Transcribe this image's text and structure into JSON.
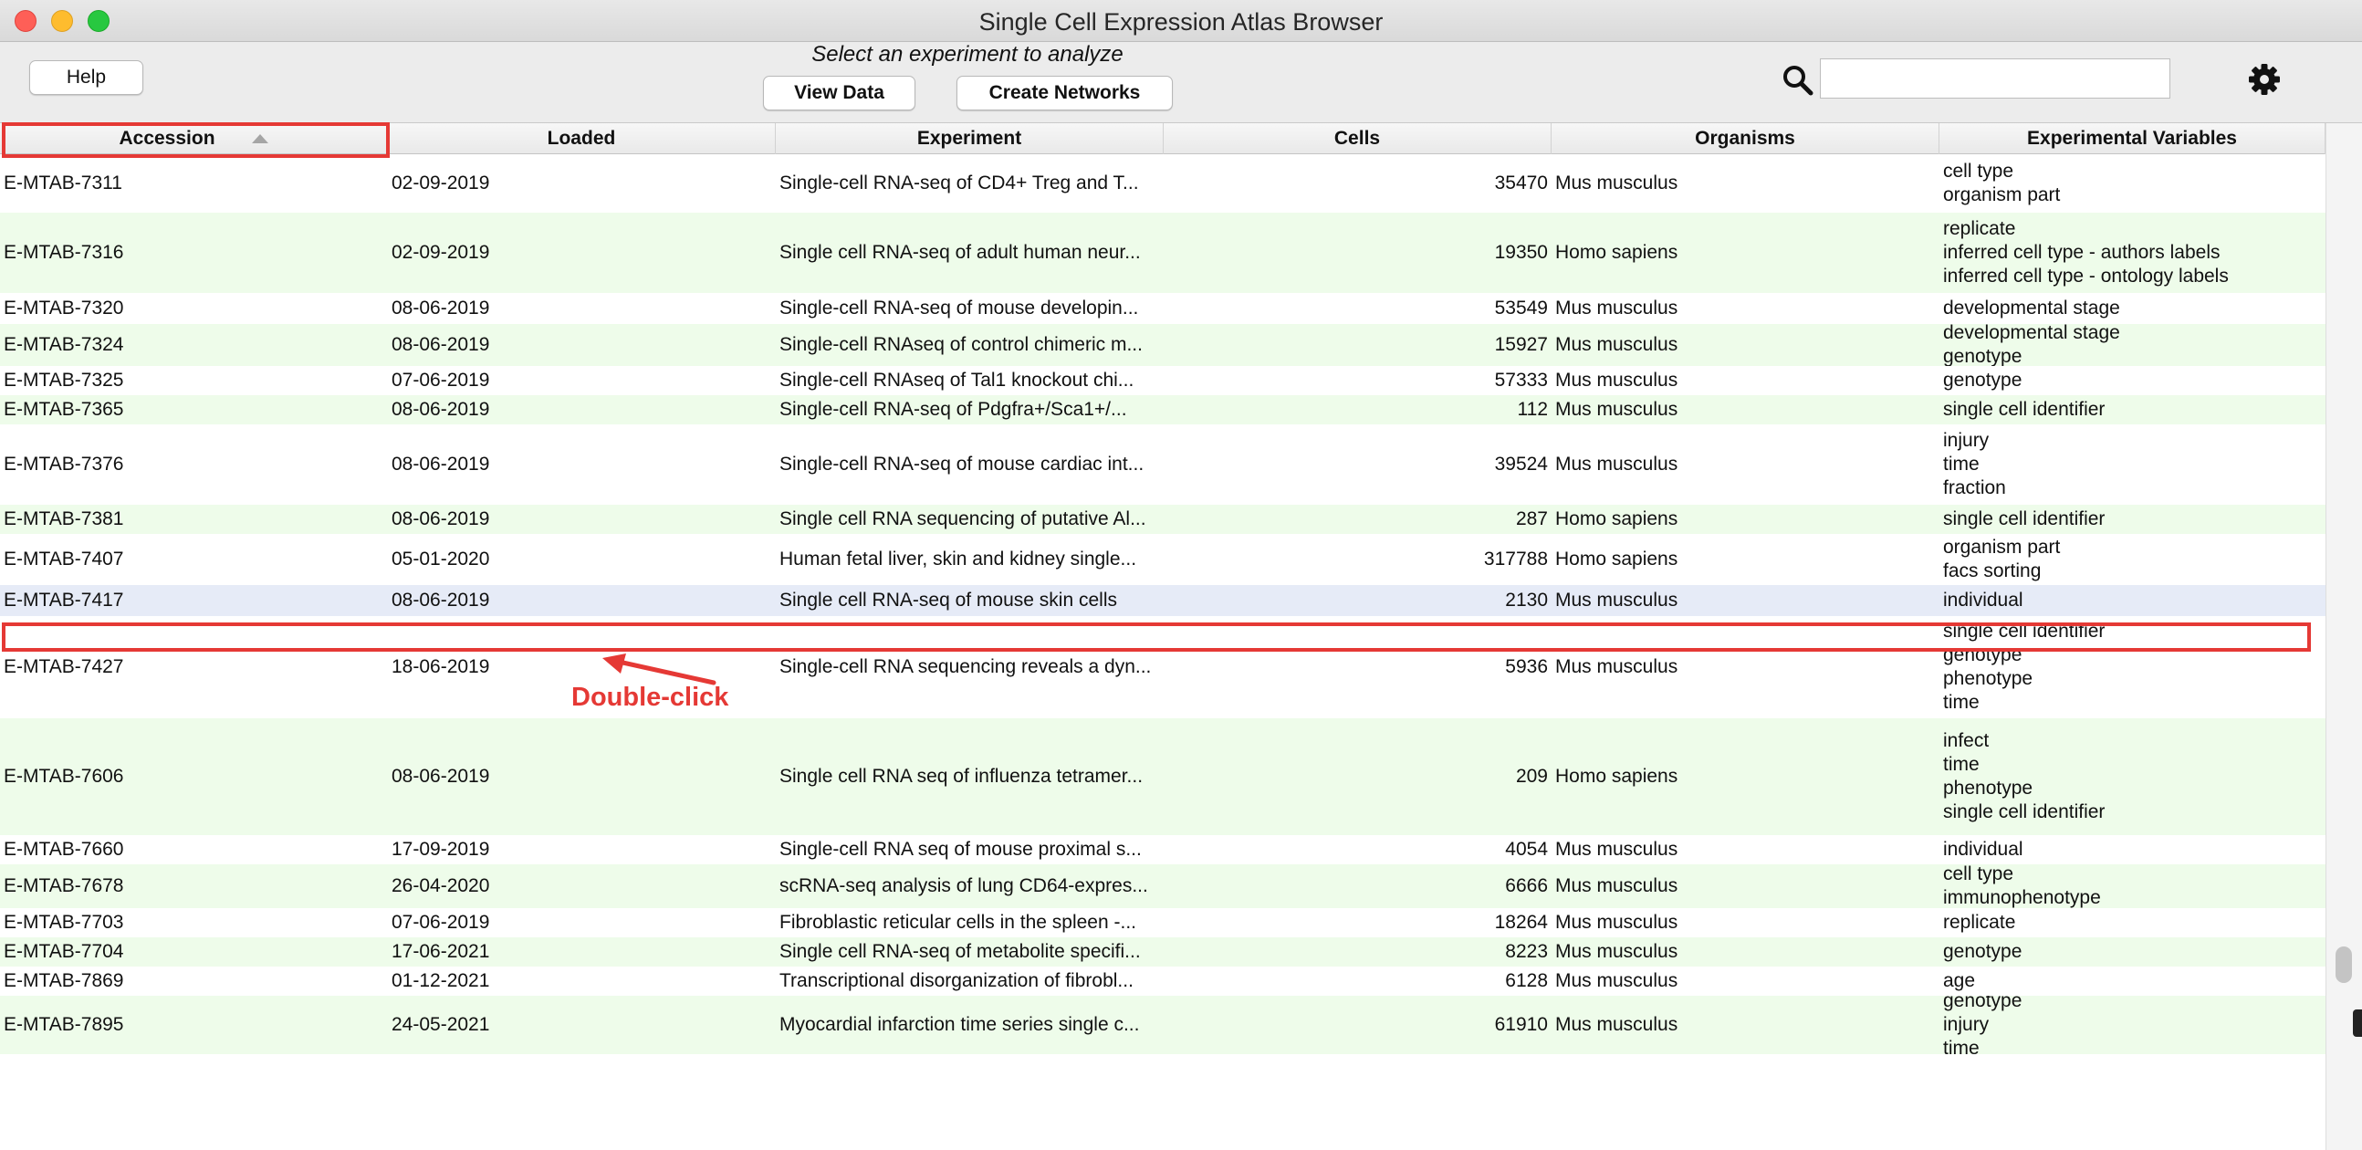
{
  "window": {
    "title": "Single Cell Expression Atlas Browser"
  },
  "toolbar": {
    "help_label": "Help",
    "prompt": "Select an experiment to analyze",
    "view_data_label": "View Data",
    "create_networks_label": "Create Networks",
    "search_value": "",
    "search_icon": "search-icon",
    "settings_icon": "gear-icon"
  },
  "table": {
    "columns": [
      "Accession",
      "Loaded",
      "Experiment",
      "Cells",
      "Organisms",
      "Experimental Variables"
    ],
    "sorted_by": "Accession",
    "rows": [
      {
        "accession": "E-MTAB-7311",
        "loaded": "02-09-2019",
        "experiment": "Single-cell RNA-seq of CD4+ Treg and T...",
        "cells": "35470",
        "organism": "Mus musculus",
        "variables": [
          "cell type",
          "organism part"
        ]
      },
      {
        "accession": "E-MTAB-7316",
        "loaded": "02-09-2019",
        "experiment": "Single cell RNA-seq of adult human neur...",
        "cells": "19350",
        "organism": "Homo sapiens",
        "variables": [
          "replicate",
          "inferred cell type - authors labels",
          "inferred cell type - ontology labels"
        ]
      },
      {
        "accession": "E-MTAB-7320",
        "loaded": "08-06-2019",
        "experiment": "Single-cell RNA-seq of mouse developin...",
        "cells": "53549",
        "organism": "Mus musculus",
        "variables": [
          "developmental stage"
        ]
      },
      {
        "accession": "E-MTAB-7324",
        "loaded": "08-06-2019",
        "experiment": "Single-cell RNAseq of control chimeric m...",
        "cells": "15927",
        "organism": "Mus musculus",
        "variables": [
          "developmental stage",
          "genotype"
        ]
      },
      {
        "accession": "E-MTAB-7325",
        "loaded": "07-06-2019",
        "experiment": "Single-cell RNAseq of Tal1 knockout chi...",
        "cells": "57333",
        "organism": "Mus musculus",
        "variables": [
          "genotype"
        ]
      },
      {
        "accession": "E-MTAB-7365",
        "loaded": "08-06-2019",
        "experiment": "Single-cell RNA-seq of Pdgfra+/Sca1+/...",
        "cells": "112",
        "organism": "Mus musculus",
        "variables": [
          "single cell identifier"
        ]
      },
      {
        "accession": "E-MTAB-7376",
        "loaded": "08-06-2019",
        "experiment": "Single-cell RNA-seq of mouse cardiac int...",
        "cells": "39524",
        "organism": "Mus musculus",
        "variables": [
          "injury",
          "time",
          "fraction"
        ]
      },
      {
        "accession": "E-MTAB-7381",
        "loaded": "08-06-2019",
        "experiment": "Single cell RNA sequencing of putative Al...",
        "cells": "287",
        "organism": "Homo sapiens",
        "variables": [
          "single cell identifier"
        ]
      },
      {
        "accession": "E-MTAB-7407",
        "loaded": "05-01-2020",
        "experiment": "Human fetal liver, skin and kidney single...",
        "cells": "317788",
        "organism": "Homo sapiens",
        "variables": [
          "organism part",
          "facs sorting"
        ]
      },
      {
        "accession": "E-MTAB-7417",
        "loaded": "08-06-2019",
        "experiment": "Single cell RNA-seq of mouse skin cells",
        "cells": "2130",
        "organism": "Mus musculus",
        "variables": [
          "individual"
        ],
        "selected": true
      },
      {
        "accession": "E-MTAB-7427",
        "loaded": "18-06-2019",
        "experiment": "Single-cell RNA sequencing reveals a dyn...",
        "cells": "5936",
        "organism": "Mus musculus",
        "variables": [
          "single cell identifier",
          "genotype",
          "phenotype",
          "time"
        ]
      },
      {
        "accession": "E-MTAB-7606",
        "loaded": "08-06-2019",
        "experiment": "Single cell RNA seq of influenza tetramer...",
        "cells": "209",
        "organism": "Homo sapiens",
        "variables": [
          "infect",
          "time",
          "phenotype",
          "single cell identifier"
        ]
      },
      {
        "accession": "E-MTAB-7660",
        "loaded": "17-09-2019",
        "experiment": "Single-cell RNA seq of mouse proximal s...",
        "cells": "4054",
        "organism": "Mus musculus",
        "variables": [
          "individual"
        ]
      },
      {
        "accession": "E-MTAB-7678",
        "loaded": "26-04-2020",
        "experiment": "scRNA-seq analysis of lung CD64-expres...",
        "cells": "6666",
        "organism": "Mus musculus",
        "variables": [
          "cell type",
          "immunophenotype"
        ]
      },
      {
        "accession": "E-MTAB-7703",
        "loaded": "07-06-2019",
        "experiment": "Fibroblastic reticular cells in the spleen -...",
        "cells": "18264",
        "organism": "Mus musculus",
        "variables": [
          "replicate"
        ]
      },
      {
        "accession": "E-MTAB-7704",
        "loaded": "17-06-2021",
        "experiment": "Single cell RNA-seq of metabolite specifi...",
        "cells": "8223",
        "organism": "Mus musculus",
        "variables": [
          "genotype"
        ]
      },
      {
        "accession": "E-MTAB-7869",
        "loaded": "01-12-2021",
        "experiment": "Transcriptional disorganization of fibrobl...",
        "cells": "6128",
        "organism": "Mus musculus",
        "variables": [
          "age"
        ]
      },
      {
        "accession": "E-MTAB-7895",
        "loaded": "24-05-2021",
        "experiment": "Myocardial infarction time series single c...",
        "cells": "61910",
        "organism": "Mus musculus",
        "variables": [
          "genotype",
          "injury",
          "time"
        ]
      }
    ]
  },
  "annotation": {
    "label": "Double-click",
    "color": "#e53935"
  },
  "colors": {
    "row_alt": "#eefcea",
    "row_selected": "#e6ebf7",
    "highlight": "#e53935"
  }
}
